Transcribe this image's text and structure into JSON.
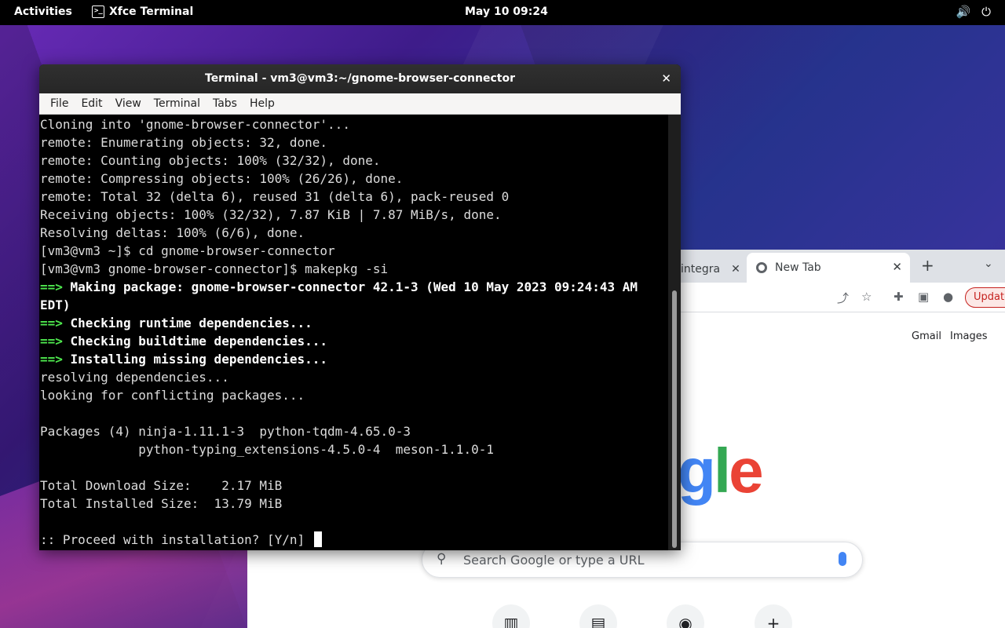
{
  "topbar": {
    "activities": "Activities",
    "app_name": "Xfce Terminal",
    "clock": "May 10  09:24",
    "volume_icon": "🔊",
    "power_icon": "⏻"
  },
  "terminal": {
    "title": "Terminal - vm3@vm3:~/gnome-browser-connector",
    "close_glyph": "✕",
    "menu": [
      "File",
      "Edit",
      "View",
      "Terminal",
      "Tabs",
      "Help"
    ],
    "lines": [
      {
        "arrow": "",
        "text": "Cloning into 'gnome-browser-connector'...",
        "bold": false
      },
      {
        "arrow": "",
        "text": "remote: Enumerating objects: 32, done.",
        "bold": false
      },
      {
        "arrow": "",
        "text": "remote: Counting objects: 100% (32/32), done.",
        "bold": false
      },
      {
        "arrow": "",
        "text": "remote: Compressing objects: 100% (26/26), done.",
        "bold": false
      },
      {
        "arrow": "",
        "text": "remote: Total 32 (delta 6), reused 31 (delta 6), pack-reused 0",
        "bold": false
      },
      {
        "arrow": "",
        "text": "Receiving objects: 100% (32/32), 7.87 KiB | 7.87 MiB/s, done.",
        "bold": false
      },
      {
        "arrow": "",
        "text": "Resolving deltas: 100% (6/6), done.",
        "bold": false
      },
      {
        "arrow": "",
        "text": "[vm3@vm3 ~]$ cd gnome-browser-connector",
        "bold": false
      },
      {
        "arrow": "",
        "text": "[vm3@vm3 gnome-browser-connector]$ makepkg -si",
        "bold": false
      },
      {
        "arrow": "==> ",
        "text": "Making package: gnome-browser-connector 42.1-3 (Wed 10 May 2023 09:24:43 AM",
        "bold": true
      },
      {
        "arrow": "",
        "text": "EDT)",
        "bold": true
      },
      {
        "arrow": "==> ",
        "text": "Checking runtime dependencies...",
        "bold": true
      },
      {
        "arrow": "==> ",
        "text": "Checking buildtime dependencies...",
        "bold": true
      },
      {
        "arrow": "==> ",
        "text": "Installing missing dependencies...",
        "bold": true
      },
      {
        "arrow": "",
        "text": "resolving dependencies...",
        "bold": false
      },
      {
        "arrow": "",
        "text": "looking for conflicting packages...",
        "bold": false
      },
      {
        "arrow": "",
        "text": "",
        "bold": false
      },
      {
        "arrow": "",
        "text": "Packages (4) ninja-1.11.1-3  python-tqdm-4.65.0-3",
        "bold": false
      },
      {
        "arrow": "",
        "text": "             python-typing_extensions-4.5.0-4  meson-1.1.0-1",
        "bold": false
      },
      {
        "arrow": "",
        "text": "",
        "bold": false
      },
      {
        "arrow": "",
        "text": "Total Download Size:    2.17 MiB",
        "bold": false
      },
      {
        "arrow": "",
        "text": "Total Installed Size:  13.79 MiB",
        "bold": false
      },
      {
        "arrow": "",
        "text": "",
        "bold": false
      }
    ],
    "prompt": ":: Proceed with installation? [Y/n] "
  },
  "browser": {
    "prev_tab_label": "integra",
    "prev_tab_close": "✕",
    "active_tab_label": "New Tab",
    "active_tab_close": "✕",
    "new_tab_glyph": "+",
    "tab_list_glyph": "⌄",
    "update_label": "Update",
    "gmail_link": "Gmail",
    "images_link": "Images",
    "logo_part_g": "g",
    "logo_part_l": "l",
    "logo_part_e": "e",
    "search_placeholder": "Search Google or type a URL",
    "share_icon": "⤴",
    "star_icon": "☆",
    "extensions_icon": "✚",
    "sidepanel_icon": "▣",
    "profile_icon": "●",
    "search_icon": "⚲",
    "shortcut_add": "+"
  }
}
